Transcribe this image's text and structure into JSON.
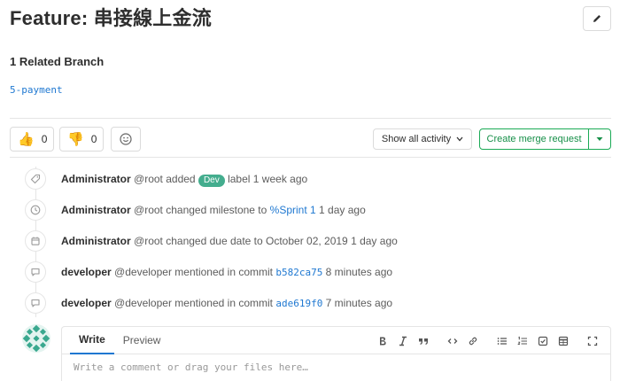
{
  "issue": {
    "title": "Feature: 串接線上金流"
  },
  "related": {
    "heading": "1 Related Branch",
    "branch": "5-payment"
  },
  "awards": {
    "thumbs_up": {
      "emoji": "👍",
      "count": "0"
    },
    "thumbs_down": {
      "emoji": "👎",
      "count": "0"
    }
  },
  "controls": {
    "activity_filter": "Show all activity",
    "merge_request": "Create merge request"
  },
  "events": [
    {
      "icon": "tag-icon",
      "author": "Administrator",
      "handle": "@root",
      "pre": "added",
      "label": "Dev",
      "post": "label",
      "time": "1 week ago"
    },
    {
      "icon": "clock-icon",
      "author": "Administrator",
      "handle": "@root",
      "pre": "changed milestone to",
      "ref": "%Sprint 1",
      "time": "1 day ago"
    },
    {
      "icon": "calendar-icon",
      "author": "Administrator",
      "handle": "@root",
      "pre": "changed due date to October 02, 2019",
      "time": "1 day ago"
    },
    {
      "icon": "comment-icon",
      "author": "developer",
      "handle": "@developer",
      "pre": "mentioned in commit",
      "commit": "b582ca75",
      "time": "8 minutes ago"
    },
    {
      "icon": "comment-icon",
      "author": "developer",
      "handle": "@developer",
      "pre": "mentioned in commit",
      "commit": "ade619f0",
      "time": "7 minutes ago"
    }
  ],
  "comment": {
    "tabs": {
      "write": "Write",
      "preview": "Preview"
    },
    "placeholder": "Write a comment or drag your files here…"
  },
  "colors": {
    "green": "#1aaa55",
    "link": "#1f78d1",
    "label_dev": "#44ad8e"
  }
}
